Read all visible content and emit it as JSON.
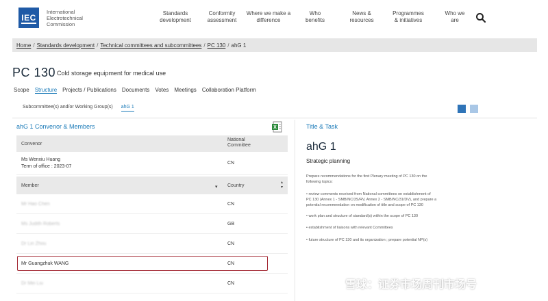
{
  "header": {
    "logo_text": "IEC",
    "org_line1": "International",
    "org_line2": "Electrotechnical",
    "org_line3": "Commission",
    "nav": [
      {
        "line1": "Standards",
        "line2": "development"
      },
      {
        "line1": "Conformity",
        "line2": "assessment"
      },
      {
        "line1": "Where we make a",
        "line2": "difference"
      },
      {
        "line1": "Who",
        "line2": "benefits"
      },
      {
        "line1": "News &",
        "line2": "resources"
      },
      {
        "line1": "Programmes",
        "line2": "& initiatives"
      },
      {
        "line1": "Who we",
        "line2": "are"
      }
    ]
  },
  "breadcrumb": [
    "Home",
    "Standards development",
    "Technical committees and subcommittees",
    "PC 130",
    "ahG 1"
  ],
  "page": {
    "code": "PC 130",
    "title": "Cold storage equipment for medical use"
  },
  "tabs": [
    "Scope",
    "Structure",
    "Projects / Publications",
    "Documents",
    "Votes",
    "Meetings",
    "Collaboration Platform"
  ],
  "active_tab": "Structure",
  "subtabs": [
    "Subcommittee(s) and/or Working Group(s)",
    "ahG 1"
  ],
  "left": {
    "heading": "ahG 1 Convenor & Members",
    "convenor_header": "Convenor",
    "national_committee_line1": "National",
    "national_committee_line2": "Committee",
    "convenor_name": "Ms Wenxiu Huang",
    "convenor_term": "Term of office : 2023-07",
    "convenor_country": "CN",
    "member_header": "Member",
    "country_header": "Country",
    "members": [
      {
        "name": "Mr Hao Chen",
        "country": "CN",
        "blurred": true
      },
      {
        "name": "Ms Judith Roberts",
        "country": "GB",
        "blurred": true
      },
      {
        "name": "Dr Lin Zhou",
        "country": "CN",
        "blurred": true
      },
      {
        "name": "Mr Guangzhuk WANG",
        "country": "CN",
        "blurred": false
      },
      {
        "name": "Dr Mei Liu",
        "country": "CN",
        "blurred": true
      }
    ]
  },
  "right": {
    "heading": "Title & Task",
    "ahg_title": "ahG 1",
    "subtitle": "Strategic planning",
    "p1_line1": "Prepare recommendations for the first Plenary meeting of PC 130 on the",
    "p1_line2": "following topics:",
    "b1_line1": "• review comments received from National committees on establishment of",
    "b1_line2": "PC 130 (Annex 1 - SMB/NC/3S/RV, Annex 2 - SMB/NC/31/DV), and prepare a",
    "b1_line3": "potential recommendation on modification of title and scope of PC 130",
    "b2": "• work plan and structure of standard(s) within the scope of PC 130",
    "b3": "• establishment of liaisons with relevant Committees",
    "b4": "• future structure of PC 130 and its organization ; prepare potential NP(s)"
  },
  "watermark": "雪球：证券市场周刊市场号",
  "colors": {
    "brand_blue": "#1f5aa6",
    "link_blue": "#1a7ab8",
    "highlight_red": "#a42a35"
  }
}
